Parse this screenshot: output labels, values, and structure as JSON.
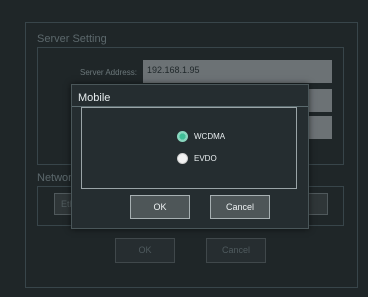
{
  "server_setting": {
    "title": "Server Setting",
    "address_label": "Server Address:",
    "address_value": "192.168.1.95"
  },
  "network": {
    "title": "Network",
    "button_partial": "Eth"
  },
  "main_buttons": {
    "ok": "OK",
    "cancel": "Cancel"
  },
  "dialog": {
    "title": "Mobile",
    "options": [
      {
        "label": "WCDMA",
        "selected": true
      },
      {
        "label": "EVDO",
        "selected": false
      }
    ],
    "ok": "OK",
    "cancel": "Cancel"
  },
  "colors": {
    "accent": "#3fbf97",
    "background": "#1f2628"
  }
}
